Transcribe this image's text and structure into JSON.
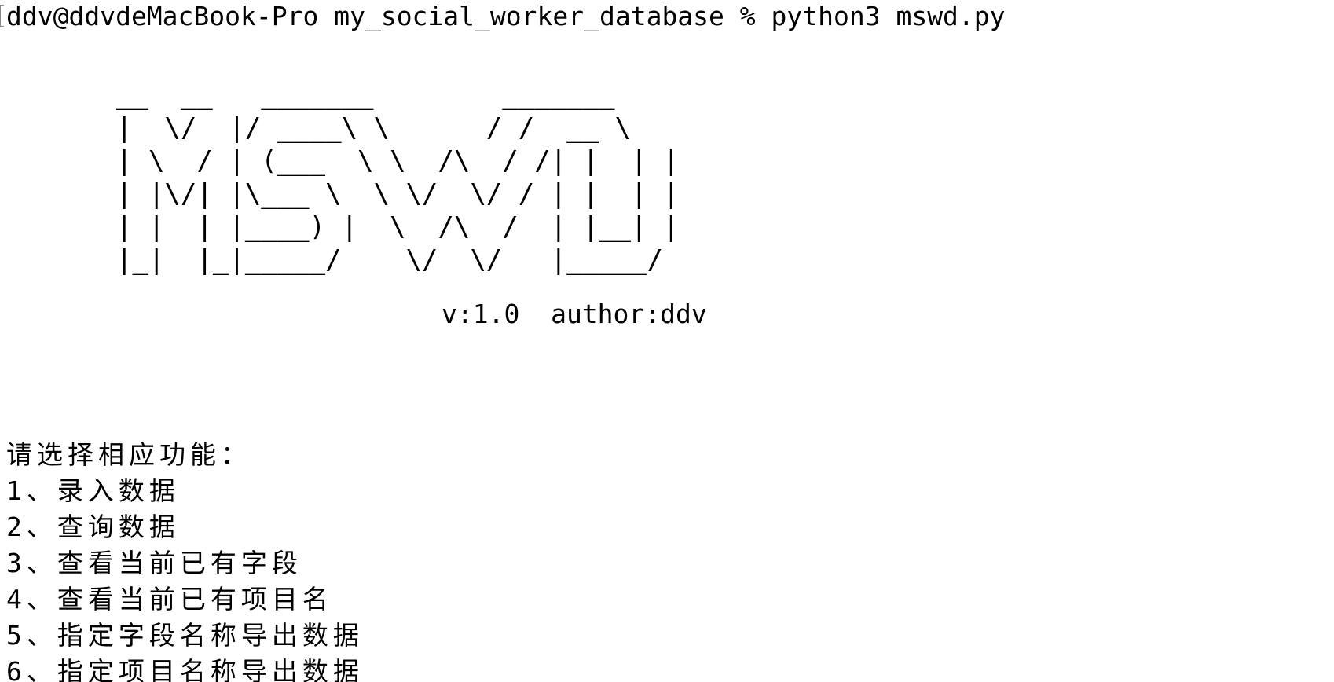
{
  "terminal": {
    "prompt_line": "ddv@ddvdeMacBook-Pro my_social_worker_database % python3 mswd.py",
    "banner": "__  __   _______        _______\n|  \\/  |/ ____\\ \\      / /  __ \\\n| \\  / | (___  \\ \\  /\\  / /| |  | |\n| |\\/| |\\___ \\  \\ \\/  \\/ / | |  | |\n| |  | |____) |  \\  /\\  /  | |__| |\n|_|  |_|_____/    \\/  \\/   |_____/",
    "version_line": "v:1.0  author:ddv",
    "menu": {
      "heading": "请选择相应功能：",
      "items": [
        {
          "label": "1、录入数据"
        },
        {
          "label": "2、查询数据"
        },
        {
          "label": "3、查看当前已有字段"
        },
        {
          "label": "4、查看当前已有项目名"
        },
        {
          "label": "5、指定字段名称导出数据"
        },
        {
          "label": "6、指定项目名称导出数据"
        }
      ]
    }
  }
}
